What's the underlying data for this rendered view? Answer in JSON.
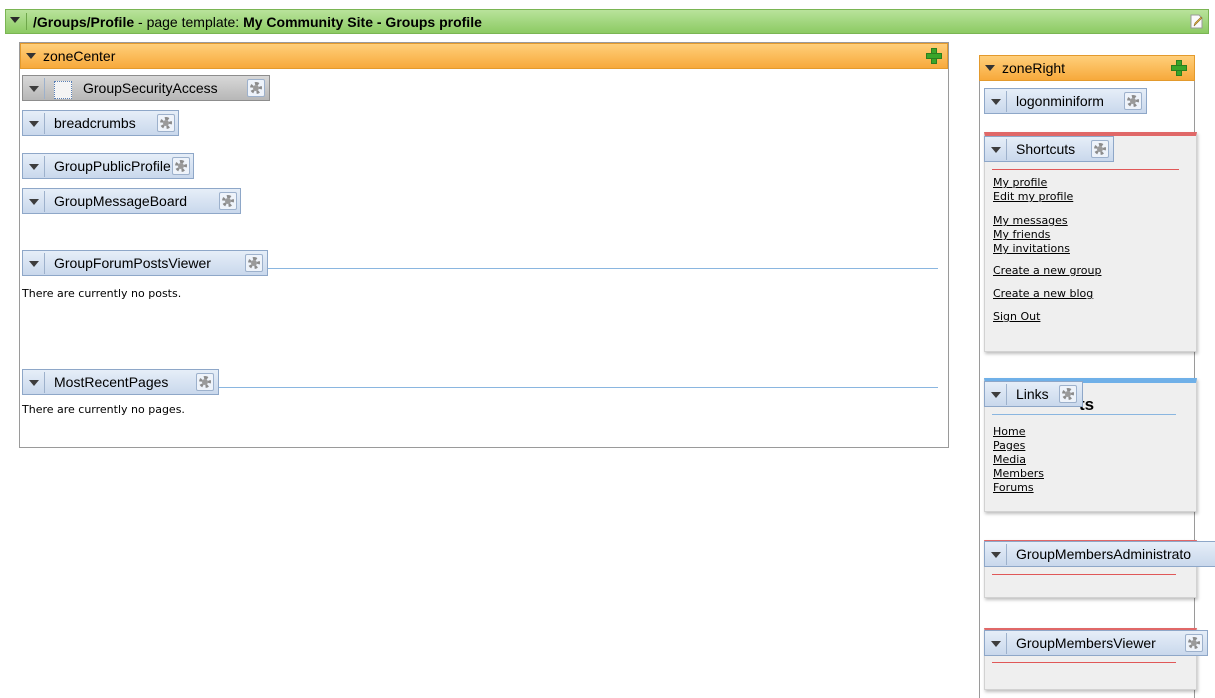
{
  "template_bar": {
    "path": "/Groups/Profile",
    "separator": " - page template: ",
    "template_name": "My Community Site - Groups profile",
    "edit_icon": "edit-page-icon"
  },
  "zone_center": {
    "label": "zoneCenter",
    "webparts": {
      "security": "GroupSecurityAccess",
      "breadcrumbs": "breadcrumbs",
      "public_profile": "GroupPublicProfile",
      "message_board": "GroupMessageBoard",
      "forum_posts": "GroupForumPostsViewer",
      "recent_pages": "MostRecentPages"
    },
    "no_posts_text": "There are currently no posts.",
    "no_pages_text": "There are currently no pages."
  },
  "zone_right": {
    "label": "zoneRight",
    "webparts": {
      "logon": "logonminiform",
      "shortcuts": "Shortcuts",
      "links": "Links",
      "members_admin": "GroupMembersAdministrato",
      "members_viewer": "GroupMembersViewer"
    },
    "shortcuts": [
      "My profile",
      "Edit my profile",
      "My messages",
      "My friends",
      "My invitations",
      "Create a new group",
      "Create a new blog",
      "Sign Out"
    ],
    "links_underlying_title_fragment": "ts",
    "links": [
      "Home",
      "Pages",
      "Media",
      "Members",
      "Forums"
    ]
  },
  "colors": {
    "template_bar": "#9fd47a",
    "zone_bar": "#f9b54c",
    "webpart_header": "#d6e2f1",
    "accent_red": "#e05858",
    "accent_blue": "#6fb0e8"
  }
}
